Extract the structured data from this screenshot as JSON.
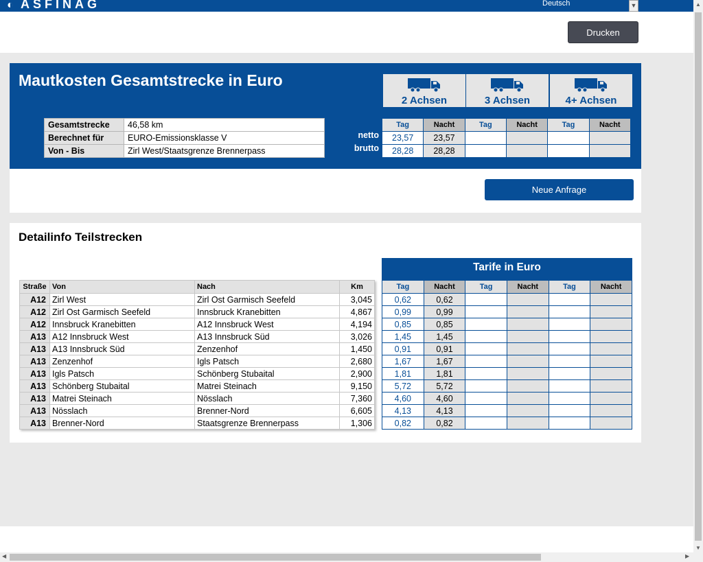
{
  "header": {
    "logo_text": "ASFINAG",
    "language": "Deutsch"
  },
  "toolbar": {
    "print_label": "Drucken"
  },
  "summary": {
    "title": "Mautkosten Gesamtstrecke in Euro",
    "rows": [
      {
        "label": "Gesamtstrecke",
        "value": "46,58 km"
      },
      {
        "label": "Berechnet für",
        "value": "EURO-Emissionsklasse V"
      },
      {
        "label": "Von - Bis",
        "value": "Zirl West/Staatsgrenze Brennerpass"
      }
    ],
    "axles": [
      {
        "label": "2 Achsen",
        "icon": "truck-icon"
      },
      {
        "label": "3 Achsen",
        "icon": "truck-icon"
      },
      {
        "label": "4+ Achsen",
        "icon": "truck-icon"
      }
    ],
    "col_tag": "Tag",
    "col_nacht": "Nacht",
    "netto_label": "netto",
    "brutto_label": "brutto",
    "netto": [
      "23,57",
      "23,57",
      "",
      "",
      "",
      ""
    ],
    "brutto": [
      "28,28",
      "28,28",
      "",
      "",
      "",
      ""
    ],
    "new_request_label": "Neue Anfrage"
  },
  "detail": {
    "title": "Detailinfo Teilstrecken",
    "columns": {
      "road": "Straße",
      "from": "Von",
      "to": "Nach",
      "km": "Km"
    },
    "tarif_title": "Tarife in Euro",
    "col_tag": "Tag",
    "col_nacht": "Nacht",
    "rows": [
      {
        "road": "A12",
        "from": "Zirl West",
        "to": "Zirl Ost Garmisch Seefeld",
        "km": "3,045",
        "tag": "0,62",
        "nacht": "0,62"
      },
      {
        "road": "A12",
        "from": "Zirl Ost Garmisch Seefeld",
        "to": "Innsbruck Kranebitten",
        "km": "4,867",
        "tag": "0,99",
        "nacht": "0,99"
      },
      {
        "road": "A12",
        "from": "Innsbruck Kranebitten",
        "to": "A12 Innsbruck West",
        "km": "4,194",
        "tag": "0,85",
        "nacht": "0,85"
      },
      {
        "road": "A13",
        "from": "A12 Innsbruck West",
        "to": "A13 Innsbruck Süd",
        "km": "3,026",
        "tag": "1,45",
        "nacht": "1,45"
      },
      {
        "road": "A13",
        "from": "A13 Innsbruck Süd",
        "to": "Zenzenhof",
        "km": "1,450",
        "tag": "0,91",
        "nacht": "0,91"
      },
      {
        "road": "A13",
        "from": "Zenzenhof",
        "to": "Igls Patsch",
        "km": "2,680",
        "tag": "1,67",
        "nacht": "1,67"
      },
      {
        "road": "A13",
        "from": "Igls Patsch",
        "to": "Schönberg Stubaital",
        "km": "2,900",
        "tag": "1,81",
        "nacht": "1,81"
      },
      {
        "road": "A13",
        "from": "Schönberg Stubaital",
        "to": "Matrei Steinach",
        "km": "9,150",
        "tag": "5,72",
        "nacht": "5,72"
      },
      {
        "road": "A13",
        "from": "Matrei Steinach",
        "to": "Nösslach",
        "km": "7,360",
        "tag": "4,60",
        "nacht": "4,60"
      },
      {
        "road": "A13",
        "from": "Nösslach",
        "to": "Brenner-Nord",
        "km": "6,605",
        "tag": "4,13",
        "nacht": "4,13"
      },
      {
        "road": "A13",
        "from": "Brenner-Nord",
        "to": "Staatsgrenze Brennerpass",
        "km": "1,306",
        "tag": "0,82",
        "nacht": "0,82"
      }
    ]
  }
}
